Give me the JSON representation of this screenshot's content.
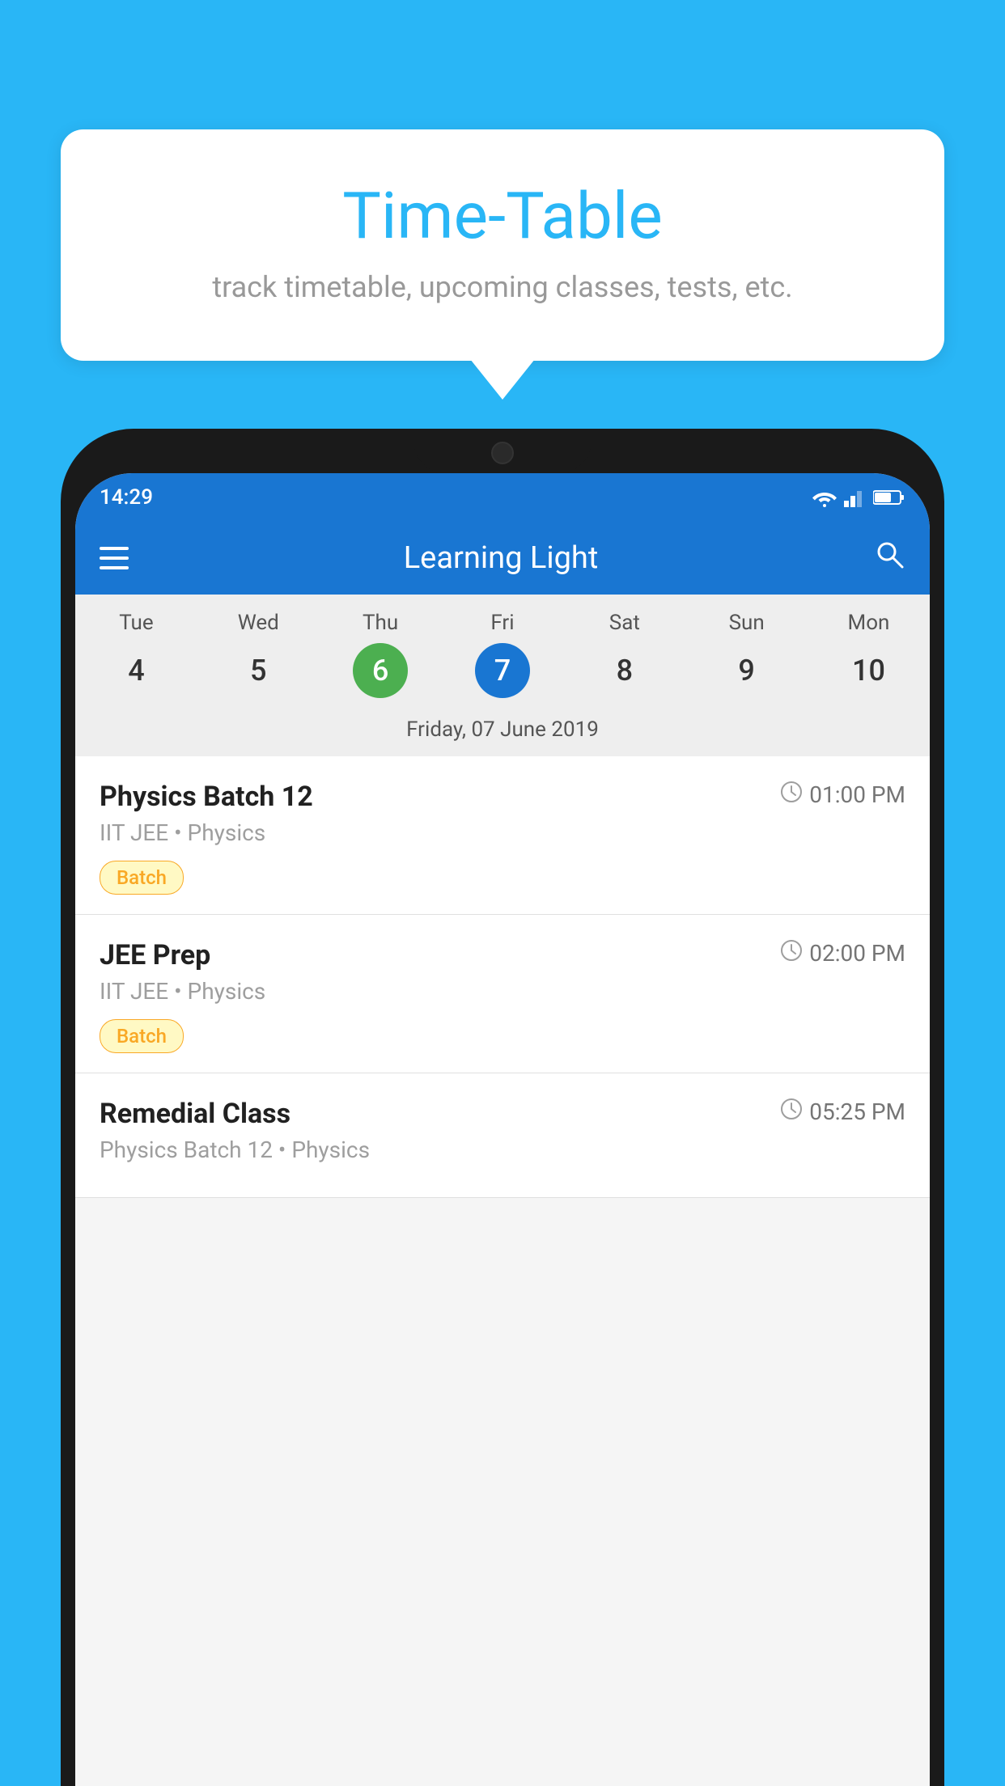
{
  "page": {
    "background_color": "#29B6F6"
  },
  "bubble": {
    "title": "Time-Table",
    "subtitle": "track timetable, upcoming classes, tests, etc."
  },
  "status_bar": {
    "time": "14:29"
  },
  "app_bar": {
    "title": "Learning Light"
  },
  "calendar": {
    "selected_date_label": "Friday, 07 June 2019",
    "days": [
      {
        "label": "Tue",
        "number": "4",
        "state": "normal"
      },
      {
        "label": "Wed",
        "number": "5",
        "state": "normal"
      },
      {
        "label": "Thu",
        "number": "6",
        "state": "today"
      },
      {
        "label": "Fri",
        "number": "7",
        "state": "selected"
      },
      {
        "label": "Sat",
        "number": "8",
        "state": "normal"
      },
      {
        "label": "Sun",
        "number": "9",
        "state": "normal"
      },
      {
        "label": "Mon",
        "number": "10",
        "state": "normal"
      }
    ]
  },
  "classes": [
    {
      "title": "Physics Batch 12",
      "time": "01:00 PM",
      "subtitle": "IIT JEE • Physics",
      "badge": "Batch"
    },
    {
      "title": "JEE Prep",
      "time": "02:00 PM",
      "subtitle": "IIT JEE • Physics",
      "badge": "Batch"
    },
    {
      "title": "Remedial Class",
      "time": "05:25 PM",
      "subtitle": "Physics Batch 12 • Physics",
      "badge": ""
    }
  ]
}
